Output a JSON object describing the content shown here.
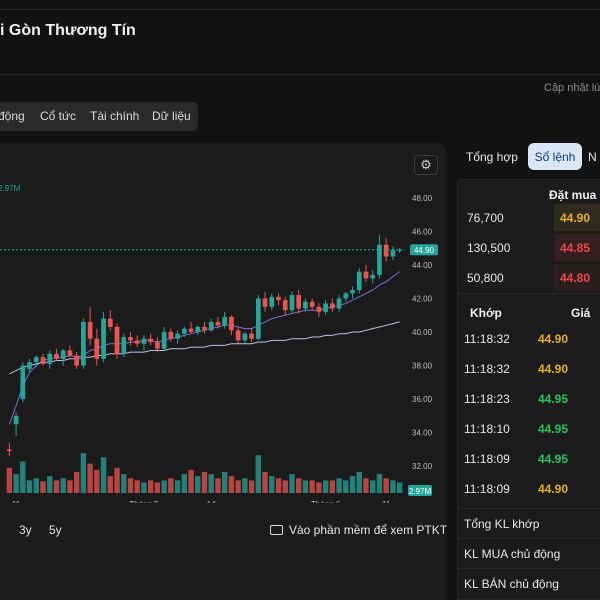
{
  "header": {
    "title": "i Gòn Thương Tín",
    "updated": "Cập nhật lú"
  },
  "tabs": [
    "động",
    "Cổ tức",
    "Tài chính",
    "Dữ liệu"
  ],
  "chart": {
    "vol_label_top": "2.97M",
    "vol_label_badge": "2.97M",
    "price_badge": "44.90",
    "y_ticks": [
      "48.00",
      "46.00",
      "44.00",
      "42.00",
      "40.00",
      "38.00",
      "36.00",
      "34.00",
      "32.00"
    ],
    "x_ticks": [
      "11",
      "Tháng 5",
      "14",
      "Tháng 6",
      "11"
    ],
    "range_buttons": [
      "3y",
      "5y"
    ],
    "ptkt_label": "Vào phần mềm để xem PTKT"
  },
  "chart_data": {
    "type": "candlestick",
    "ylim": [
      31,
      49
    ],
    "last_price": 44.9,
    "volume_last": "2.97M",
    "candles": [
      {
        "o": 33.0,
        "h": 33.4,
        "l": 32.6,
        "c": 32.9
      },
      {
        "o": 34.5,
        "h": 35.2,
        "l": 33.8,
        "c": 35.0
      },
      {
        "o": 36.0,
        "h": 38.2,
        "l": 35.8,
        "c": 38.0
      },
      {
        "o": 37.8,
        "h": 38.4,
        "l": 37.6,
        "c": 38.2
      },
      {
        "o": 38.2,
        "h": 38.6,
        "l": 37.9,
        "c": 38.5
      },
      {
        "o": 38.5,
        "h": 38.7,
        "l": 38.0,
        "c": 38.1
      },
      {
        "o": 38.1,
        "h": 38.9,
        "l": 37.8,
        "c": 38.7
      },
      {
        "o": 38.7,
        "h": 39.0,
        "l": 38.3,
        "c": 38.4
      },
      {
        "o": 38.4,
        "h": 39.0,
        "l": 38.0,
        "c": 38.9
      },
      {
        "o": 38.9,
        "h": 39.2,
        "l": 38.5,
        "c": 38.6
      },
      {
        "o": 38.6,
        "h": 38.8,
        "l": 37.8,
        "c": 38.0
      },
      {
        "o": 38.0,
        "h": 40.8,
        "l": 37.8,
        "c": 40.6
      },
      {
        "o": 40.6,
        "h": 41.5,
        "l": 39.2,
        "c": 39.6
      },
      {
        "o": 39.6,
        "h": 40.2,
        "l": 38.0,
        "c": 38.4
      },
      {
        "o": 38.4,
        "h": 41.2,
        "l": 38.2,
        "c": 40.8
      },
      {
        "o": 40.8,
        "h": 41.3,
        "l": 40.1,
        "c": 40.3
      },
      {
        "o": 40.3,
        "h": 40.5,
        "l": 38.4,
        "c": 38.7
      },
      {
        "o": 38.7,
        "h": 39.9,
        "l": 38.5,
        "c": 39.7
      },
      {
        "o": 39.7,
        "h": 40.0,
        "l": 39.2,
        "c": 39.5
      },
      {
        "o": 39.5,
        "h": 39.8,
        "l": 39.1,
        "c": 39.3
      },
      {
        "o": 39.3,
        "h": 39.8,
        "l": 38.9,
        "c": 39.6
      },
      {
        "o": 39.6,
        "h": 39.9,
        "l": 39.2,
        "c": 39.4
      },
      {
        "o": 39.4,
        "h": 39.7,
        "l": 38.8,
        "c": 39.0
      },
      {
        "o": 39.0,
        "h": 40.3,
        "l": 38.9,
        "c": 40.0
      },
      {
        "o": 40.0,
        "h": 40.2,
        "l": 39.4,
        "c": 39.6
      },
      {
        "o": 39.6,
        "h": 40.1,
        "l": 39.3,
        "c": 39.9
      },
      {
        "o": 39.9,
        "h": 40.3,
        "l": 39.7,
        "c": 40.2
      },
      {
        "o": 40.2,
        "h": 40.6,
        "l": 39.9,
        "c": 40.0
      },
      {
        "o": 40.0,
        "h": 40.4,
        "l": 39.8,
        "c": 40.3
      },
      {
        "o": 40.3,
        "h": 40.6,
        "l": 39.9,
        "c": 40.1
      },
      {
        "o": 40.1,
        "h": 40.8,
        "l": 40.0,
        "c": 40.6
      },
      {
        "o": 40.6,
        "h": 40.9,
        "l": 40.2,
        "c": 40.4
      },
      {
        "o": 40.4,
        "h": 41.2,
        "l": 40.2,
        "c": 40.9
      },
      {
        "o": 40.9,
        "h": 41.0,
        "l": 39.8,
        "c": 40.1
      },
      {
        "o": 40.1,
        "h": 40.3,
        "l": 39.3,
        "c": 39.5
      },
      {
        "o": 39.5,
        "h": 40.0,
        "l": 39.3,
        "c": 39.9
      },
      {
        "o": 39.9,
        "h": 40.2,
        "l": 39.4,
        "c": 39.6
      },
      {
        "o": 39.6,
        "h": 42.2,
        "l": 39.5,
        "c": 42.0
      },
      {
        "o": 42.0,
        "h": 42.4,
        "l": 41.2,
        "c": 41.5
      },
      {
        "o": 41.5,
        "h": 42.3,
        "l": 41.3,
        "c": 42.1
      },
      {
        "o": 42.1,
        "h": 42.3,
        "l": 41.6,
        "c": 41.9
      },
      {
        "o": 41.9,
        "h": 42.1,
        "l": 41.0,
        "c": 41.3
      },
      {
        "o": 41.3,
        "h": 42.4,
        "l": 41.1,
        "c": 42.2
      },
      {
        "o": 42.2,
        "h": 42.5,
        "l": 41.1,
        "c": 41.4
      },
      {
        "o": 41.4,
        "h": 42.0,
        "l": 41.2,
        "c": 41.8
      },
      {
        "o": 41.8,
        "h": 42.0,
        "l": 41.3,
        "c": 41.5
      },
      {
        "o": 41.5,
        "h": 41.7,
        "l": 40.9,
        "c": 41.2
      },
      {
        "o": 41.2,
        "h": 41.9,
        "l": 41.0,
        "c": 41.7
      },
      {
        "o": 41.7,
        "h": 42.0,
        "l": 41.2,
        "c": 41.4
      },
      {
        "o": 41.4,
        "h": 42.2,
        "l": 41.2,
        "c": 42.0
      },
      {
        "o": 42.0,
        "h": 42.4,
        "l": 41.8,
        "c": 42.3
      },
      {
        "o": 42.3,
        "h": 42.7,
        "l": 42.0,
        "c": 42.5
      },
      {
        "o": 42.5,
        "h": 43.8,
        "l": 42.3,
        "c": 43.6
      },
      {
        "o": 43.6,
        "h": 44.0,
        "l": 43.0,
        "c": 43.2
      },
      {
        "o": 43.2,
        "h": 43.7,
        "l": 42.9,
        "c": 43.4
      },
      {
        "o": 43.4,
        "h": 45.8,
        "l": 43.2,
        "c": 45.2
      },
      {
        "o": 45.2,
        "h": 45.6,
        "l": 44.2,
        "c": 44.5
      },
      {
        "o": 44.5,
        "h": 45.1,
        "l": 44.3,
        "c": 44.9
      },
      {
        "o": 44.9,
        "h": 45.0,
        "l": 44.7,
        "c": 44.9
      }
    ],
    "volumes_rel": [
      0.6,
      0.45,
      0.75,
      0.3,
      0.35,
      0.28,
      0.4,
      0.3,
      0.35,
      0.3,
      0.5,
      0.95,
      0.7,
      0.55,
      0.85,
      0.4,
      0.6,
      0.45,
      0.35,
      0.3,
      0.25,
      0.3,
      0.25,
      0.3,
      0.35,
      0.3,
      0.45,
      0.55,
      0.4,
      0.5,
      0.45,
      0.35,
      0.5,
      0.4,
      0.3,
      0.35,
      0.3,
      0.9,
      0.5,
      0.4,
      0.35,
      0.3,
      0.45,
      0.35,
      0.3,
      0.3,
      0.25,
      0.3,
      0.3,
      0.35,
      0.3,
      0.4,
      0.5,
      0.35,
      0.3,
      0.45,
      0.35,
      0.3,
      0.25
    ],
    "ma_short": [
      34.5,
      35.6,
      36.8,
      37.6,
      38.0,
      38.3,
      38.4,
      38.5,
      38.5,
      38.6,
      38.5,
      38.6,
      38.9,
      39.0,
      39.2,
      39.3,
      39.3,
      39.3,
      39.4,
      39.4,
      39.5,
      39.5,
      39.4,
      39.5,
      39.6,
      39.7,
      39.8,
      39.9,
      40.0,
      40.1,
      40.2,
      40.3,
      40.4,
      40.4,
      40.3,
      40.2,
      40.2,
      40.4,
      40.6,
      40.8,
      40.9,
      41.0,
      41.1,
      41.2,
      41.3,
      41.3,
      41.3,
      41.4,
      41.5,
      41.6,
      41.7,
      41.9,
      42.1,
      42.3,
      42.5,
      42.8,
      43.0,
      43.3,
      43.6
    ],
    "ma_long": [
      37.5,
      37.7,
      37.9,
      38.0,
      38.1,
      38.2,
      38.2,
      38.3,
      38.3,
      38.4,
      38.4,
      38.5,
      38.5,
      38.6,
      38.6,
      38.7,
      38.7,
      38.7,
      38.8,
      38.8,
      38.8,
      38.9,
      38.9,
      38.9,
      39.0,
      39.0,
      39.0,
      39.1,
      39.1,
      39.1,
      39.2,
      39.2,
      39.2,
      39.3,
      39.3,
      39.3,
      39.3,
      39.4,
      39.4,
      39.5,
      39.5,
      39.5,
      39.6,
      39.6,
      39.6,
      39.7,
      39.7,
      39.8,
      39.8,
      39.9,
      39.9,
      40.0,
      40.0,
      40.1,
      40.2,
      40.3,
      40.4,
      40.5,
      40.6
    ]
  },
  "right_tabs": [
    "Tổng hợp",
    "Sổ lệnh",
    "N"
  ],
  "orderbook": {
    "header": "Đặt mua",
    "bids": [
      {
        "vol": "76,700",
        "price": "44.90",
        "color": "#e8b020"
      },
      {
        "vol": "130,500",
        "price": "44.85",
        "color": "#f04848"
      },
      {
        "vol": "50,800",
        "price": "44.80",
        "color": "#f04848"
      }
    ],
    "trade_headers": {
      "match": "Khớp",
      "price": "Giá"
    },
    "trades": [
      {
        "time": "11:18:32",
        "price": "44.90",
        "color": "#e8b020"
      },
      {
        "time": "11:18:32",
        "price": "44.90",
        "color": "#e8b020"
      },
      {
        "time": "11:18:23",
        "price": "44.95",
        "color": "#22c55e"
      },
      {
        "time": "11:18:10",
        "price": "44.95",
        "color": "#22c55e"
      },
      {
        "time": "11:18:09",
        "price": "44.95",
        "color": "#22c55e"
      },
      {
        "time": "11:18:09",
        "price": "44.90",
        "color": "#e8b020"
      }
    ],
    "summary": [
      "Tổng KL khớp",
      "KL MUA chủ động",
      "KL BÁN chủ động"
    ]
  },
  "colors": {
    "up": "#26a69a",
    "down": "#ef5350",
    "accent_tab": "#dbe7f7"
  }
}
